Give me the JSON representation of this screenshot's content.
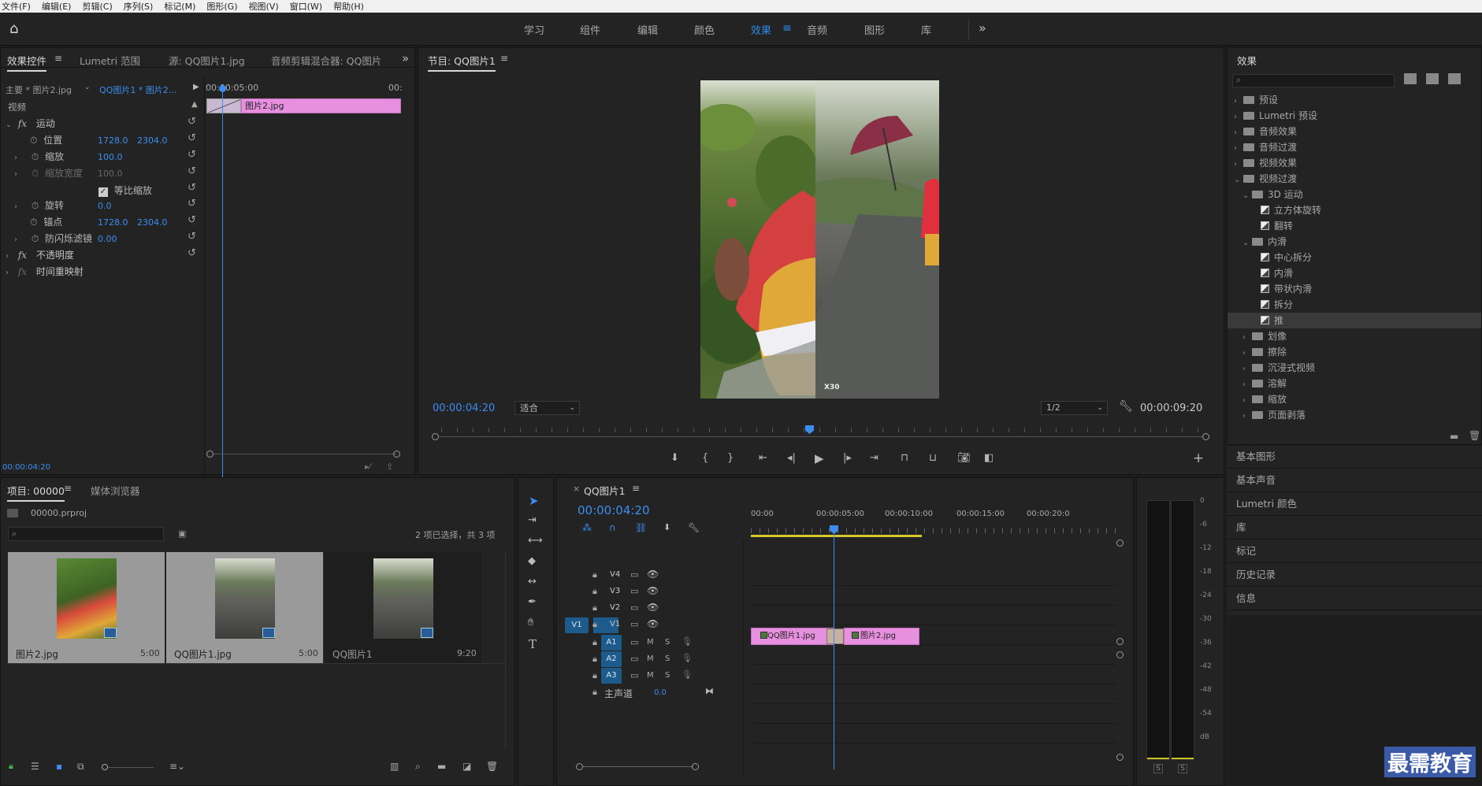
{
  "menu": [
    "文件(F)",
    "编辑(E)",
    "剪辑(C)",
    "序列(S)",
    "标记(M)",
    "图形(G)",
    "视图(V)",
    "窗口(W)",
    "帮助(H)"
  ],
  "workspaces": [
    "学习",
    "组件",
    "编辑",
    "颜色",
    "效果",
    "音频",
    "图形",
    "库"
  ],
  "workspace_active": "效果",
  "effect_controls": {
    "tabs": [
      "效果控件",
      "Lumetri 范围",
      "源: QQ图片1.jpg",
      "音频剪辑混合器: QQ图片"
    ],
    "master": "主要 * 图片2.jpg",
    "sequence": "QQ图片1 * 图片2...",
    "timecode_start": "00:00:05:00",
    "timecode_end": "00:",
    "clip_name": "图片2.jpg",
    "section_video": "视频",
    "motion": "运动",
    "position_label": "位置",
    "position_x": "1728.0",
    "position_y": "2304.0",
    "scale_label": "缩放",
    "scale_value": "100.0",
    "scale_width_label": "缩放宽度",
    "scale_width_value": "100.0",
    "uniform_scale": "等比缩放",
    "rotation_label": "旋转",
    "rotation_value": "0.0",
    "anchor_label": "锚点",
    "anchor_x": "1728.0",
    "anchor_y": "2304.0",
    "antiflicker_label": "防闪烁滤镜",
    "antiflicker_value": "0.00",
    "opacity": "不透明度",
    "time_remap": "时间重映射",
    "current_time": "00:00:04:20"
  },
  "program": {
    "title": "节目: QQ图片1",
    "timecode": "00:00:04:20",
    "fit": "适合",
    "quality": "1/2",
    "duration": "00:00:09:20",
    "watermark": "X30"
  },
  "effects_panel": {
    "title": "效果",
    "tree": [
      {
        "label": "预设",
        "level": 0,
        "kind": "folder",
        "open": false
      },
      {
        "label": "Lumetri 预设",
        "level": 0,
        "kind": "folder",
        "open": false
      },
      {
        "label": "音频效果",
        "level": 0,
        "kind": "folder",
        "open": false
      },
      {
        "label": "音频过渡",
        "level": 0,
        "kind": "folder",
        "open": false
      },
      {
        "label": "视频效果",
        "level": 0,
        "kind": "folder",
        "open": false
      },
      {
        "label": "视频过渡",
        "level": 0,
        "kind": "folder",
        "open": true
      },
      {
        "label": "3D 运动",
        "level": 1,
        "kind": "folder",
        "open": true
      },
      {
        "label": "立方体旋转",
        "level": 2,
        "kind": "fx"
      },
      {
        "label": "翻转",
        "level": 2,
        "kind": "fx"
      },
      {
        "label": "内滑",
        "level": 1,
        "kind": "folder",
        "open": true
      },
      {
        "label": "中心拆分",
        "level": 2,
        "kind": "fx"
      },
      {
        "label": "内滑",
        "level": 2,
        "kind": "fx"
      },
      {
        "label": "带状内滑",
        "level": 2,
        "kind": "fx"
      },
      {
        "label": "拆分",
        "level": 2,
        "kind": "fx"
      },
      {
        "label": "推",
        "level": 2,
        "kind": "fx",
        "selected": true
      },
      {
        "label": "划像",
        "level": 1,
        "kind": "folder",
        "open": false
      },
      {
        "label": "擦除",
        "level": 1,
        "kind": "folder",
        "open": false
      },
      {
        "label": "沉浸式视频",
        "level": 1,
        "kind": "folder",
        "open": false
      },
      {
        "label": "溶解",
        "level": 1,
        "kind": "folder",
        "open": false
      },
      {
        "label": "缩放",
        "level": 1,
        "kind": "folder",
        "open": false
      },
      {
        "label": "页面剥落",
        "level": 1,
        "kind": "folder",
        "open": false
      }
    ],
    "panels": [
      "基本图形",
      "基本声音",
      "Lumetri 颜色",
      "库",
      "标记",
      "历史记录",
      "信息"
    ]
  },
  "project": {
    "tabs": [
      "项目: 00000",
      "媒体浏览器"
    ],
    "file": "00000.prproj",
    "selection": "2 项已选择，共 3 项",
    "items": [
      {
        "name": "图片2.jpg",
        "duration": "5:00"
      },
      {
        "name": "QQ图片1.jpg",
        "duration": "5:00"
      },
      {
        "name": "QQ图片1",
        "duration": "9:20"
      }
    ]
  },
  "timeline": {
    "title": "QQ图片1",
    "timecode": "00:00:04:20",
    "ruler": [
      "00:00",
      "00:00:05:00",
      "00:00:10:00",
      "00:00:15:00",
      "00:00:20:0"
    ],
    "video_tracks": [
      "V4",
      "V3",
      "V2",
      "V1"
    ],
    "audio_tracks": [
      "A1",
      "A2",
      "A3"
    ],
    "master": "主声道",
    "master_value": "0.0",
    "clip1": "QQ图片1.jpg",
    "clip2": "图片2.jpg",
    "m": "M",
    "s": "S"
  },
  "meter": {
    "labels": [
      "0",
      "-6",
      "-12",
      "-18",
      "-24",
      "-30",
      "-36",
      "-42",
      "-48",
      "-54",
      "dB"
    ],
    "solo": "S"
  },
  "watermark_logo": "最需教育"
}
